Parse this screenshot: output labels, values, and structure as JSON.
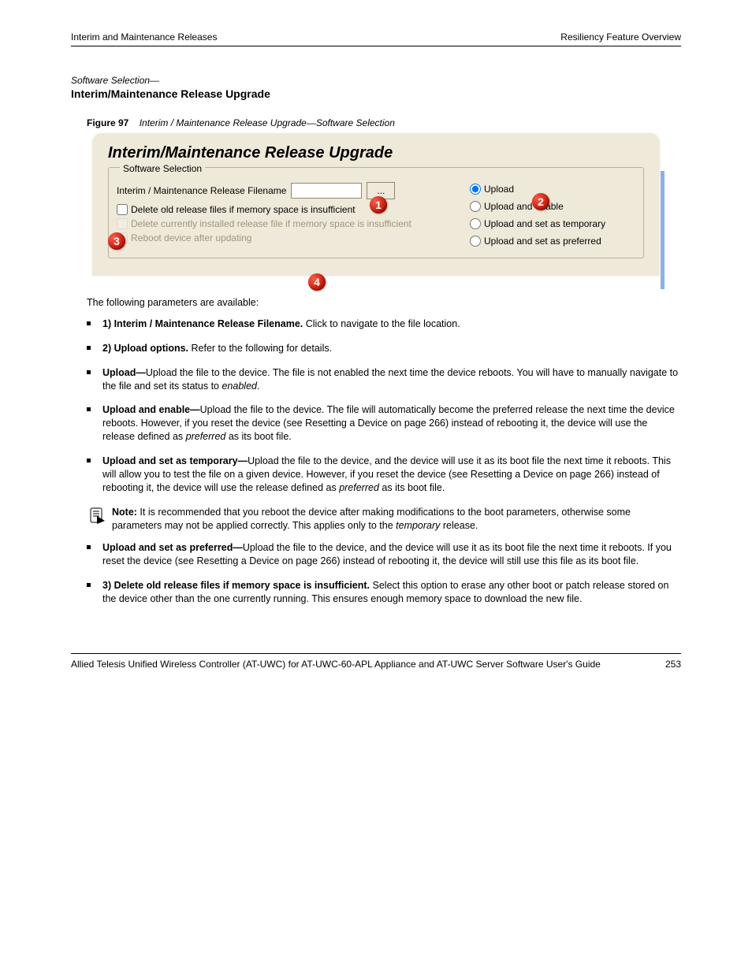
{
  "header": {
    "left": "Interim and Maintenance Releases",
    "right": "Resiliency Feature Overview"
  },
  "section": {
    "kicker": "Software Selection—",
    "title": "Interim/Maintenance Release Upgrade"
  },
  "figure": {
    "label": "Figure 97",
    "caption": "Interim / Maintenance Release Upgrade—Software Selection"
  },
  "ui": {
    "panel_title": "Interim/Maintenance Release Upgrade",
    "legend": "Software Selection",
    "filename_label": "Interim / Maintenance Release Filename",
    "filename_value": "",
    "browse_label": "...",
    "chk_delete_old": "Delete old release files if memory space is insufficient",
    "chk_delete_current": "Delete currently installed release file if memory space is insufficient",
    "chk_reboot": "Reboot device after updating",
    "radios": {
      "upload": "Upload",
      "upload_enable": "Upload and enable",
      "upload_temp": "Upload and set as temporary",
      "upload_pref": "Upload and set as preferred"
    },
    "badges": {
      "b1": "1",
      "b2": "2",
      "b3": "3",
      "b4": "4"
    }
  },
  "body": {
    "intro_lead": "The following parameters are available:",
    "b1": {
      "lead": "1) Interim / Maintenance Release Filename.",
      "text": " Click to navigate to the file location."
    },
    "b2": {
      "lead": "2) Upload options.",
      "text": " Refer to the following for details."
    },
    "b3": {
      "lead": "Upload—",
      "text": "Upload the file to the device. The file is not enabled the next time the device reboots. You will have to manually navigate to the file and set its status to ",
      "em": "enabled",
      "tail": "."
    },
    "b4": {
      "lead": "Upload and enable—",
      "text": "Upload the file to the device. The file will automatically become the preferred release the next time the device reboots. However, if you reset the device (see ",
      "link": "Resetting a Device on page 266",
      "tail_a": ") instead of rebooting it, the device will use the release defined as ",
      "em": "preferred",
      "tail_b": " as its boot file."
    },
    "b5": {
      "lead": "Upload and set as temporary—",
      "text": "Upload the file to the device, and the device will use it as its boot file the next time it reboots. This will allow you to test the file on a given device. However, if you reset the device (see ",
      "link": "Resetting a Device on page 266",
      "tail_a": ") instead of rebooting it, the device will use the release defined as ",
      "em": "preferred",
      "tail_b": " as its boot file."
    },
    "note": {
      "kw": "Note:",
      "text": " It is recommended that you reboot the device after making modifications to the boot parameters, otherwise some parameters may not be applied correctly. This applies only to the ",
      "em": "temporary",
      "tail": " release."
    },
    "b6": {
      "lead": "Upload and set as preferred—",
      "text": "Upload the file to the device, and the device will use it as its boot file the next time it reboots. If you reset the device (see ",
      "link": "Resetting a Device on page 266",
      "tail": ") instead of rebooting it, the device will still use this file as its boot file."
    },
    "b7": {
      "lead": "3) Delete old release files if memory space is insufficient.",
      "text": " Select this option to erase any other boot or patch release stored on the device other than the one currently running. This ensures enough memory space to download the new file."
    }
  },
  "footer": {
    "left": "Allied Telesis Unified Wireless Controller (AT-UWC) for AT-UWC-60-APL Appliance and AT-UWC Server Software User's Guide",
    "right": "253"
  }
}
